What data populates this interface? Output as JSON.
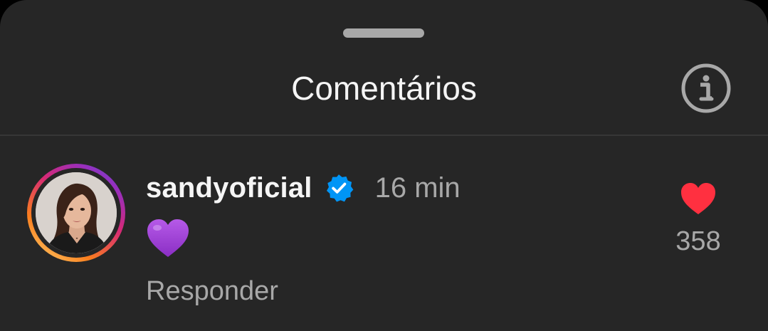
{
  "sheet": {
    "title": "Comentários",
    "info_icon": "info-circle-icon"
  },
  "comment": {
    "username": "sandyoficial",
    "verified_icon": "verified-badge-icon",
    "time": "16 min",
    "body_emoji": "purple-heart-emoji",
    "reply_label": "Responder",
    "like_icon": "heart-filled-icon",
    "likes": "358",
    "liked": true
  },
  "colors": {
    "background": "#262626",
    "text_primary": "#f5f5f5",
    "text_secondary": "#a8a8a8",
    "like_red": "#ff3040",
    "verified_blue": "#0095f6",
    "emoji_purple": "#9b3fd6"
  }
}
